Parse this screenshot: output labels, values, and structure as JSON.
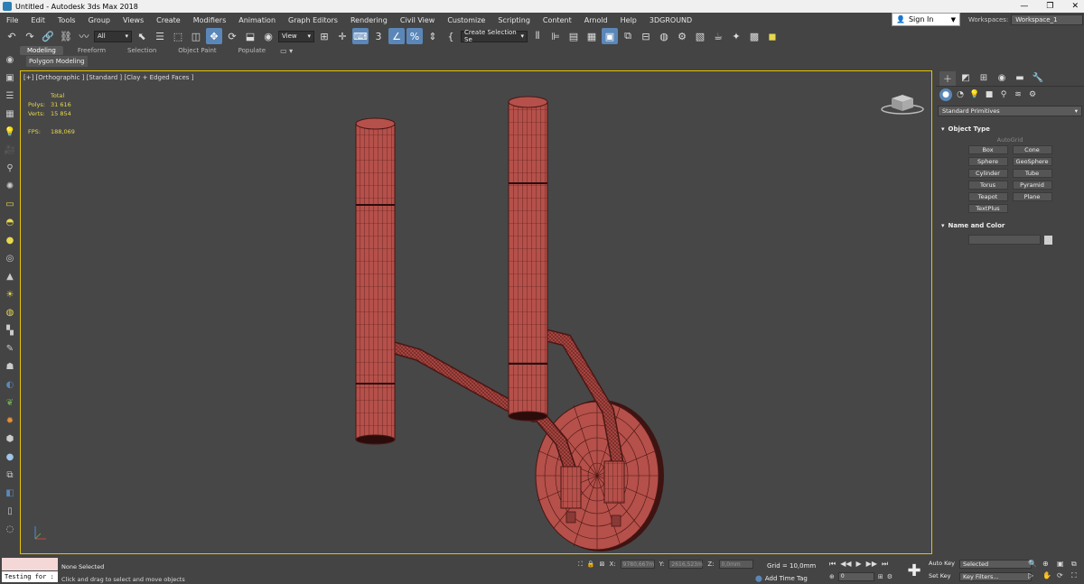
{
  "window": {
    "title": "Untitled - Autodesk 3ds Max 2018",
    "minimize": "—",
    "restore": "❐",
    "close": "✕"
  },
  "menu": {
    "items": [
      "File",
      "Edit",
      "Tools",
      "Group",
      "Views",
      "Create",
      "Modifiers",
      "Animation",
      "Graph Editors",
      "Rendering",
      "Civil View",
      "Customize",
      "Scripting",
      "Content",
      "Arnold",
      "Help",
      "3DGROUND"
    ],
    "sign_in": "Sign In",
    "workspaces_label": "Workspaces:",
    "workspace_value": "Workspace_1"
  },
  "toolbar": {
    "selection_filter": "All",
    "ref_coord": "View",
    "named_selection": "Create Selection Se"
  },
  "ribbon": {
    "tabs": [
      "Modeling",
      "Freeform",
      "Selection",
      "Object Paint",
      "Populate"
    ],
    "active_tab": "Modeling",
    "sub_label": "Polygon Modeling"
  },
  "viewport": {
    "label": "[+] [Orthographic ] [Standard ] [Clay + Edged Faces ]",
    "stats": {
      "header": "Total",
      "polys_label": "Polys:",
      "polys_value": "31 616",
      "verts_label": "Verts:",
      "verts_value": "15 854",
      "fps_label": "FPS:",
      "fps_value": "188,069"
    },
    "colors": {
      "mesh_fill": "#b5504a",
      "mesh_wire": "#4a1614",
      "background": "#474747",
      "border": "#e6c400"
    }
  },
  "command_panel": {
    "category_dropdown": "Standard Primitives",
    "object_type_title": "Object Type",
    "autogrid": "AutoGrid",
    "primitives": [
      "Box",
      "Cone",
      "Sphere",
      "GeoSphere",
      "Cylinder",
      "Tube",
      "Torus",
      "Pyramid",
      "Teapot",
      "Plane",
      "TextPlus"
    ],
    "name_color_title": "Name and Color"
  },
  "status": {
    "listener_text": "Testing for :",
    "selection_status": "None Selected",
    "prompt": "Click and drag to select and move objects",
    "x_label": "X:",
    "x_value": "9780,667m",
    "y_label": "Y:",
    "y_value": "2616,523m",
    "z_label": "Z:",
    "z_value": "0,0mm",
    "grid": "Grid = 10,0mm",
    "add_time_tag": "Add Time Tag",
    "frame_value": "0",
    "auto_key": "Auto Key",
    "key_mode": "Selected",
    "set_key": "Set Key",
    "key_filters": "Key Filters..."
  }
}
